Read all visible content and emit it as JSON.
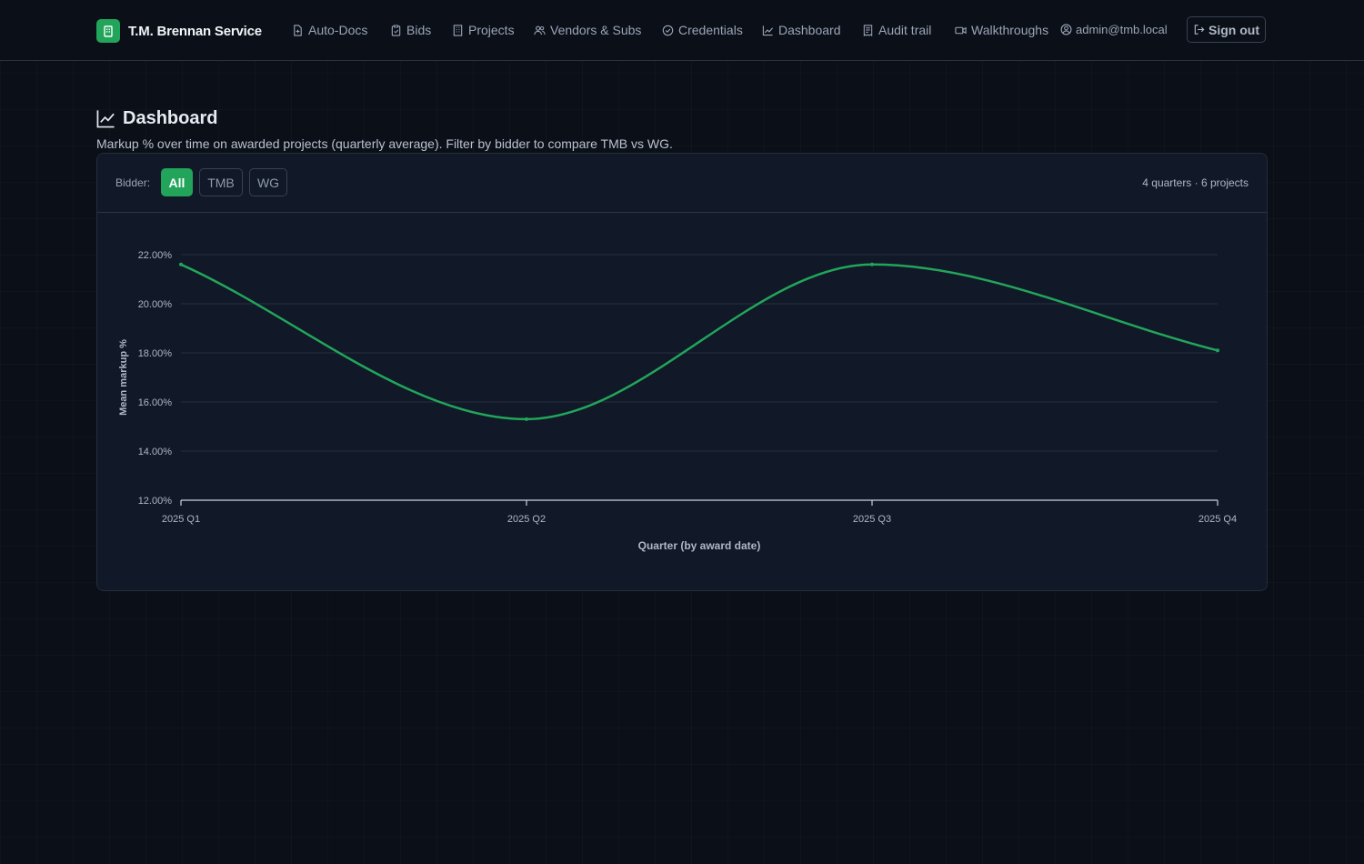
{
  "brand": {
    "name": "T.M. Brennan Service",
    "icon": "building-icon",
    "color": "#22a55a"
  },
  "nav": [
    {
      "label": "Auto-Docs",
      "icon": "file-plus-icon"
    },
    {
      "label": "Bids",
      "icon": "clipboard-icon"
    },
    {
      "label": "Projects",
      "icon": "building-icon"
    },
    {
      "label": "Vendors & Subs",
      "icon": "users-icon"
    },
    {
      "label": "Credentials",
      "icon": "check-circle-icon"
    },
    {
      "label": "Dashboard",
      "icon": "line-chart-icon"
    },
    {
      "label": "Audit trail",
      "icon": "receipt-icon"
    },
    {
      "label": "Walkthroughs",
      "icon": "video-icon"
    }
  ],
  "user": {
    "email": "admin@tmb.local",
    "icon": "user-circle-icon"
  },
  "signout": {
    "label": "Sign out",
    "icon": "sign-out-icon"
  },
  "page": {
    "title": "Dashboard",
    "subtitle": "Markup % over time on awarded projects (quarterly average). Filter by bidder to compare TMB vs WG."
  },
  "filter": {
    "label": "Bidder:",
    "options": [
      "All",
      "TMB",
      "WG"
    ],
    "selected": "All",
    "accent": "#22a55a"
  },
  "meta": "4 quarters · 6 projects",
  "chart_data": {
    "type": "line",
    "categories": [
      "2025 Q1",
      "2025 Q2",
      "2025 Q3",
      "2025 Q4"
    ],
    "series": [
      {
        "values": [
          21.6,
          15.3,
          21.6,
          18.1
        ],
        "color": "#22a55a"
      }
    ],
    "xlabel": "Quarter (by award date)",
    "ylabel": "Mean markup %",
    "ylim": [
      12,
      22
    ],
    "yticks": [
      "12.00%",
      "14.00%",
      "16.00%",
      "18.00%",
      "20.00%",
      "22.00%"
    ],
    "grid": true,
    "smooth": true
  }
}
